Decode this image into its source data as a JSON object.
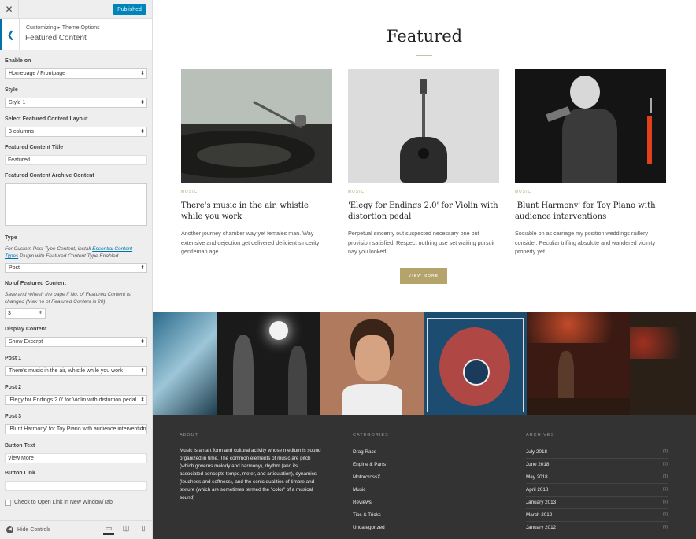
{
  "customizer": {
    "publish_label": "Published",
    "breadcrumb": "Customizing ▸ Theme Options",
    "section_title": "Featured Content",
    "fields": {
      "enable_on": {
        "label": "Enable on",
        "value": "Homepage / Frontpage"
      },
      "style": {
        "label": "Style",
        "value": "Style 1"
      },
      "layout": {
        "label": "Select Featured Content Layout",
        "value": "3 columns"
      },
      "title": {
        "label": "Featured Content Title",
        "value": "Featured"
      },
      "archive": {
        "label": "Featured Content Archive Content",
        "value": ""
      },
      "type": {
        "label": "Type",
        "desc_pre": "For Custom Post Type Content, install ",
        "desc_link": "Essential Content Types",
        "desc_post": " Plugin with Featured Content Type Enabled",
        "value": "Post"
      },
      "number": {
        "label": "No of Featured Content",
        "desc": "Save and refresh the page if No. of Featured Content is changed (Max no of Featured Content is 20)",
        "value": "3"
      },
      "display": {
        "label": "Display Content",
        "value": "Show Excerpt"
      },
      "post1": {
        "label": "Post 1",
        "value": "There's music in the air, whistle while you work"
      },
      "post2": {
        "label": "Post 2",
        "value": "'Elegy for Endings 2.0' for Violin with distortion pedal"
      },
      "post3": {
        "label": "Post 3",
        "value": "'Blunt Harmony' for Toy Piano with audience interventions"
      },
      "button_text": {
        "label": "Button Text",
        "value": "View More"
      },
      "button_link": {
        "label": "Button Link",
        "value": ""
      },
      "new_window": {
        "label": "Check to Open Link in New Window/Tab"
      }
    },
    "hide_controls": "Hide Controls"
  },
  "preview": {
    "featured_title": "Featured",
    "posts": [
      {
        "category": "MUSIC",
        "title": "There's music in the air, whistle while you work",
        "excerpt": "Another journey chamber way yet females man. Way extensive and dejection get delivered deficient sincerity gentleman age."
      },
      {
        "category": "MUSIC",
        "title": "'Elegy for Endings 2.0' for Violin with dis­tortion pedal",
        "excerpt": "Perpetual sincerity out suspected necessary one but provision satisfied. Respect nothing use set waiting pursuit nay you looked."
      },
      {
        "category": "MUSIC",
        "title": "'Blunt Harmony' for Toy Piano with audi­ence interventions",
        "excerpt": "Sociable on as carriage my position weddings raillery consider. Peculiar trifling absolute and wandered vicinity property yet."
      }
    ],
    "view_more": "VIEW MORE",
    "footer": {
      "about_heading": "ABOUT",
      "about_text": "Music is an art form and cultural activity whose medium is sound organized in time. The common elements of music are pitch (which governs melody and harmony), rhythm (and its associated concepts tempo, meter, and articulation), dynamics (loudness and softness), and the sonic qualities of timbre and texture (which are sometimes termed the \"color\" of a musical sound)",
      "categories_heading": "CATEGORIES",
      "categories": [
        "Drag Race",
        "Engine & Parts",
        "MotorcrossX",
        "Music",
        "Reviews",
        "Tips & Tricks",
        "Uncategorized"
      ],
      "archives_heading": "ARCHIVES",
      "archives": [
        {
          "label": "July 2018",
          "count": "(3)"
        },
        {
          "label": "June 2018",
          "count": "(1)"
        },
        {
          "label": "May 2018",
          "count": "(3)"
        },
        {
          "label": "April 2018",
          "count": "(1)"
        },
        {
          "label": "January 2013",
          "count": "(6)"
        },
        {
          "label": "March 2012",
          "count": "(5)"
        },
        {
          "label": "January 2012",
          "count": "(6)"
        }
      ]
    }
  }
}
